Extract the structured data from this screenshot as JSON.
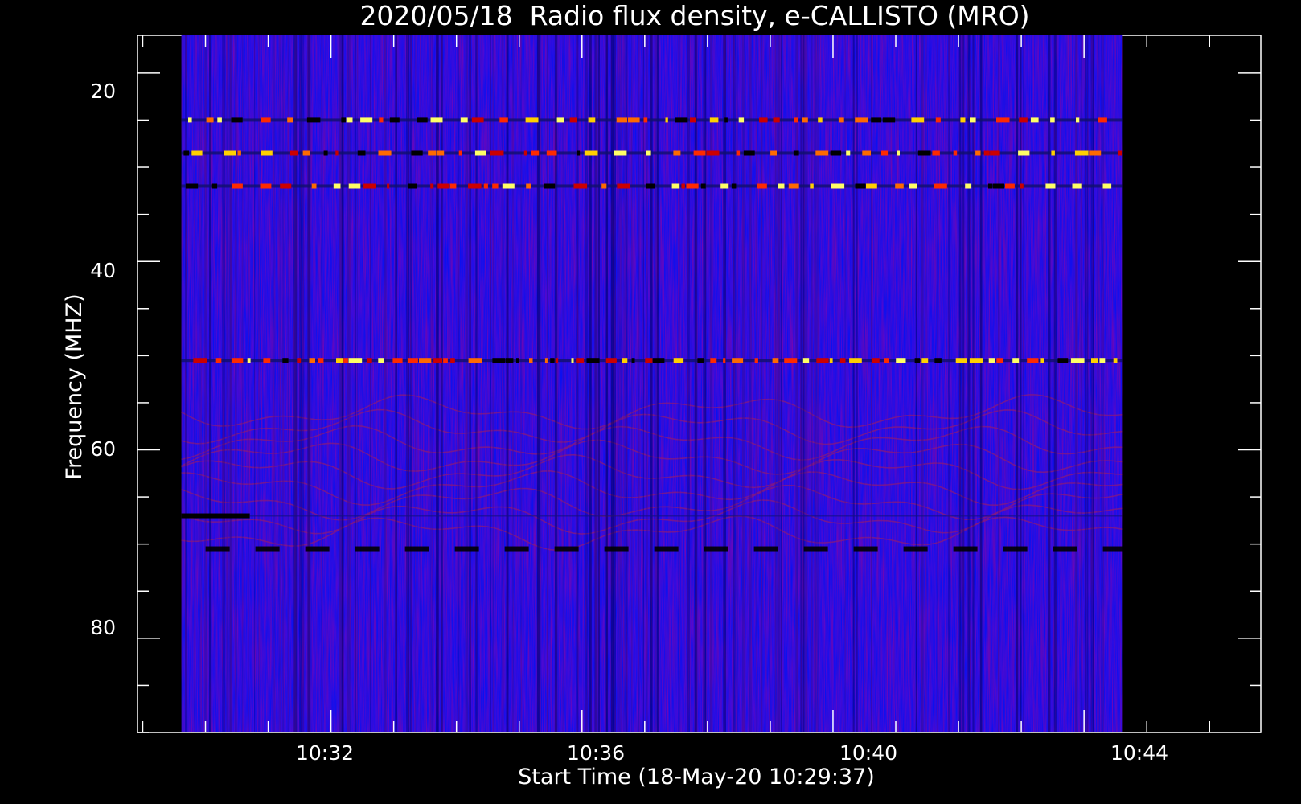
{
  "chart_data": {
    "type": "heatmap",
    "title": "2020/05/18  Radio flux density, e-CALLISTO (MRO)",
    "xlabel": "Start Time (18-May-20 10:29:37)",
    "ylabel": "Frequency (MHZ)",
    "x_ticks": [
      "10:32",
      "10:36",
      "10:40",
      "10:44"
    ],
    "y_ticks": [
      "20",
      "40",
      "60",
      "80"
    ],
    "x_tick_values_min": [
      2.383,
      6.383,
      10.383,
      14.383
    ],
    "x_range_min": [
      -0.7,
      17.2
    ],
    "data_x_range_min": [
      0.0,
      15.0
    ],
    "y_range_mhz": [
      90.0,
      16.0
    ],
    "data_y_range_mhz": [
      16.0,
      90.0
    ],
    "colormap": [
      "#000000",
      "#0000ff",
      "#ff0000",
      "#ffff00",
      "#ffffff"
    ],
    "background_color": "#0a10f0",
    "bright_bands_mhz": [
      25.0,
      28.5,
      32.0,
      50.5
    ],
    "dark_bands_mhz": [
      67.0,
      70.5
    ],
    "grid": false
  }
}
